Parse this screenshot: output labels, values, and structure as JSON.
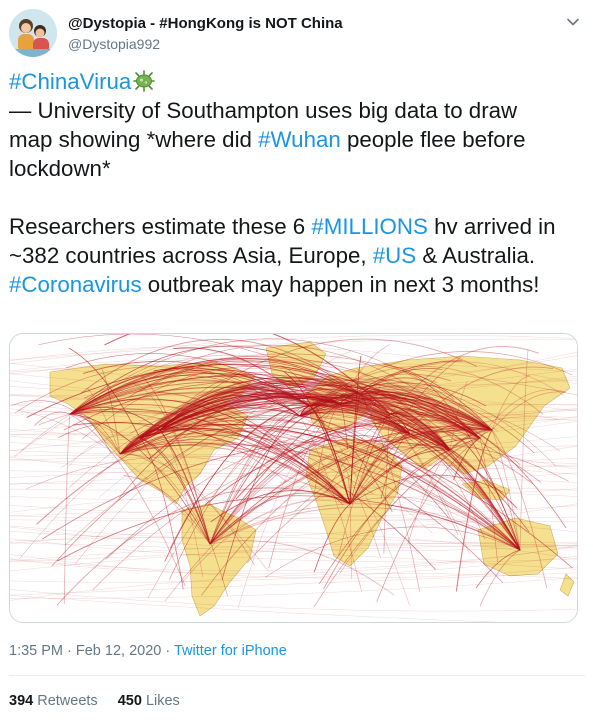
{
  "author": {
    "display_name": "@Dystopia - #HongKong is NOT China",
    "handle": "@Dystopia992"
  },
  "tweet": {
    "line1_tag": "#ChinaVirua",
    "line1_emoji": "microbe-emoji",
    "line2": "— University of Southampton uses big data to draw",
    "line3_pre": "map showing *where did ",
    "line3_tag": "#Wuhan",
    "line3_post": " people flee before",
    "line4": "lockdown*",
    "line5_pre": "Researchers estimate these 6 ",
    "line5_tag": "#MILLIONS",
    "line5_post": " hv arrived in",
    "line6_pre": "~382 countries across Asia, Europe, ",
    "line6_tag": "#US",
    "line6_post": " & Australia.",
    "line7_tag": "#Coronavirus",
    "line7_post": " outbreak may happen in next 3 months!"
  },
  "media": {
    "type": "world flight-route map",
    "land_color": "#f4e08e",
    "route_color": "#b3101a"
  },
  "meta": {
    "time": "1:35 PM",
    "separator1": " · ",
    "date": "Feb 12, 2020",
    "separator2": " · ",
    "source": "Twitter for iPhone"
  },
  "stats": {
    "retweets_count": "394",
    "retweets_label": "Retweets",
    "likes_count": "450",
    "likes_label": "Likes"
  },
  "colors": {
    "link": "#1b95e0",
    "secondary_text": "#657786",
    "divider": "#e6ecf0"
  }
}
